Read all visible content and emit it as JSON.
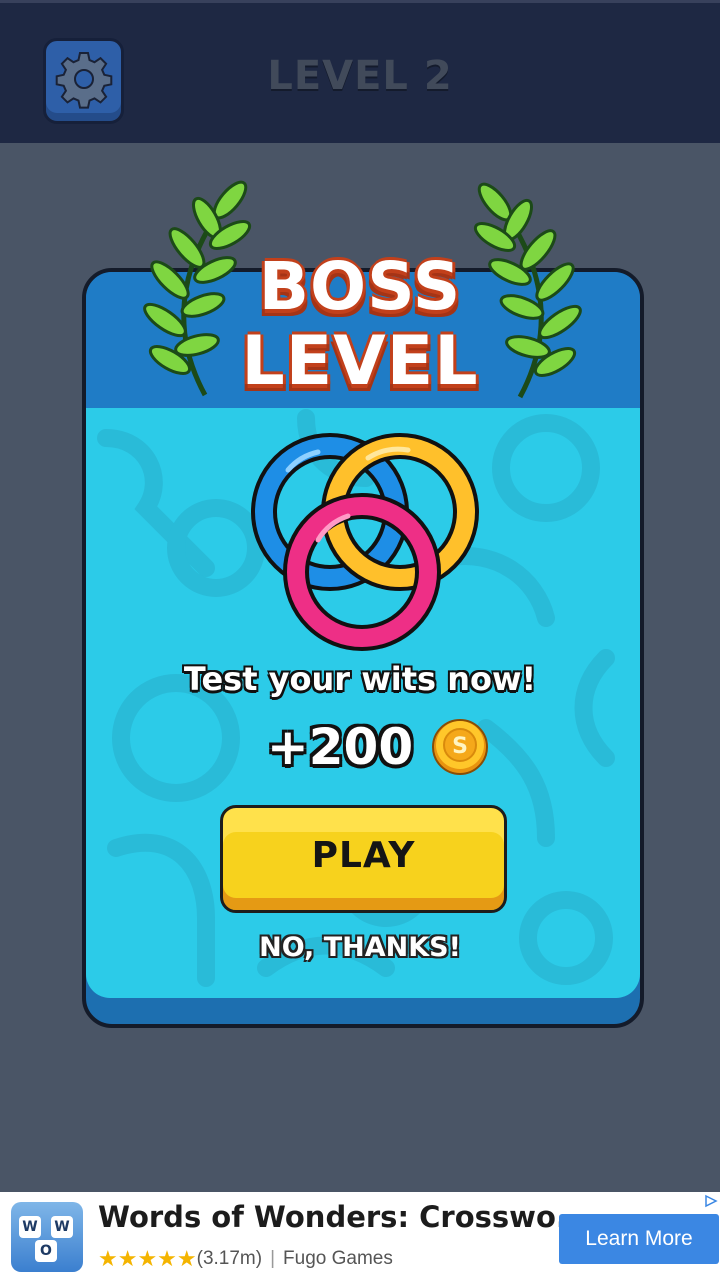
{
  "header": {
    "level_title": "LEVEL 2",
    "settings_icon": "gear-icon"
  },
  "modal": {
    "title_line1": "BOSS",
    "title_line2": "LEVEL",
    "tagline": "Test your wits now!",
    "reward_amount": "+200",
    "reward_icon": "coin-icon",
    "coin_symbol": "S",
    "play_label": "PLAY",
    "decline_label": "NO, THANKS!"
  },
  "ad": {
    "title": "Words of Wonders: Crosswo...",
    "rating_stars": "★★★★★",
    "review_count": "(3.17m)",
    "developer": "Fugo Games",
    "cta_label": "Learn More",
    "icon_letters": [
      "W",
      "W",
      "O"
    ]
  },
  "colors": {
    "background": "#4a5566",
    "topbar": "#1e2843",
    "card_header": "#1f7cc6",
    "card_body": "#2ccbe8",
    "play_button": "#f7d21d",
    "ring_blue": "#1e8ee6",
    "ring_orange": "#ffc02b",
    "ring_pink": "#ee2f86",
    "cta": "#3b87e3"
  }
}
